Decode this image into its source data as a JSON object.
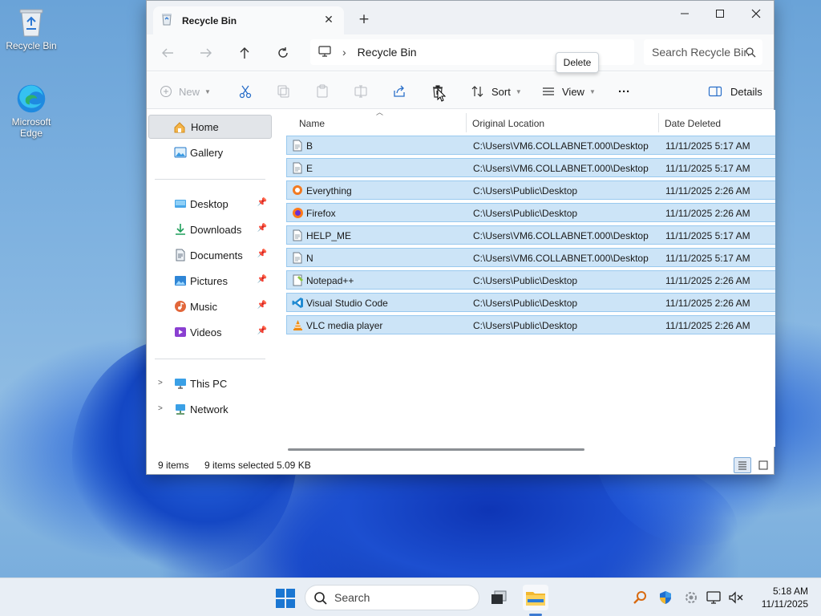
{
  "desktop": {
    "icons": [
      {
        "label": "Recycle Bin"
      },
      {
        "label": "Microsoft Edge"
      }
    ]
  },
  "window": {
    "tab_title": "Recycle Bin",
    "address": {
      "location": "Recycle Bin"
    },
    "search": {
      "placeholder": "Search Recycle Bin"
    },
    "toolbar": {
      "new_label": "New",
      "sort_label": "Sort",
      "view_label": "View",
      "more_label": "···",
      "details_label": "Details"
    },
    "tooltip": "Delete",
    "sidebar": {
      "items": [
        {
          "label": "Home"
        },
        {
          "label": "Gallery"
        },
        {
          "label": "Desktop"
        },
        {
          "label": "Downloads"
        },
        {
          "label": "Documents"
        },
        {
          "label": "Pictures"
        },
        {
          "label": "Music"
        },
        {
          "label": "Videos"
        },
        {
          "label": "This PC"
        },
        {
          "label": "Network"
        }
      ]
    },
    "columns": {
      "name": "Name",
      "location": "Original Location",
      "date": "Date Deleted"
    },
    "rows": [
      {
        "name": "B",
        "location": "C:\\Users\\VM6.COLLABNET.000\\Desktop",
        "date": "11/11/2025 5:17 AM"
      },
      {
        "name": "E",
        "location": "C:\\Users\\VM6.COLLABNET.000\\Desktop",
        "date": "11/11/2025 5:17 AM"
      },
      {
        "name": "Everything",
        "location": "C:\\Users\\Public\\Desktop",
        "date": "11/11/2025 2:26 AM"
      },
      {
        "name": "Firefox",
        "location": "C:\\Users\\Public\\Desktop",
        "date": "11/11/2025 2:26 AM"
      },
      {
        "name": "HELP_ME",
        "location": "C:\\Users\\VM6.COLLABNET.000\\Desktop",
        "date": "11/11/2025 5:17 AM"
      },
      {
        "name": "N",
        "location": "C:\\Users\\VM6.COLLABNET.000\\Desktop",
        "date": "11/11/2025 5:17 AM"
      },
      {
        "name": "Notepad++",
        "location": "C:\\Users\\Public\\Desktop",
        "date": "11/11/2025 2:26 AM"
      },
      {
        "name": "Visual Studio Code",
        "location": "C:\\Users\\Public\\Desktop",
        "date": "11/11/2025 2:26 AM"
      },
      {
        "name": "VLC media player",
        "location": "C:\\Users\\Public\\Desktop",
        "date": "11/11/2025 2:26 AM"
      }
    ],
    "status": {
      "count": "9 items",
      "selected": "9 items selected",
      "size": "5.09 KB"
    }
  },
  "taskbar": {
    "search_label": "Search",
    "time": "5:18 AM",
    "date": "11/11/2025"
  },
  "colors": {
    "selection": "#cce4f7",
    "selection_border": "#99c9ef",
    "accent": "#0067c0"
  }
}
